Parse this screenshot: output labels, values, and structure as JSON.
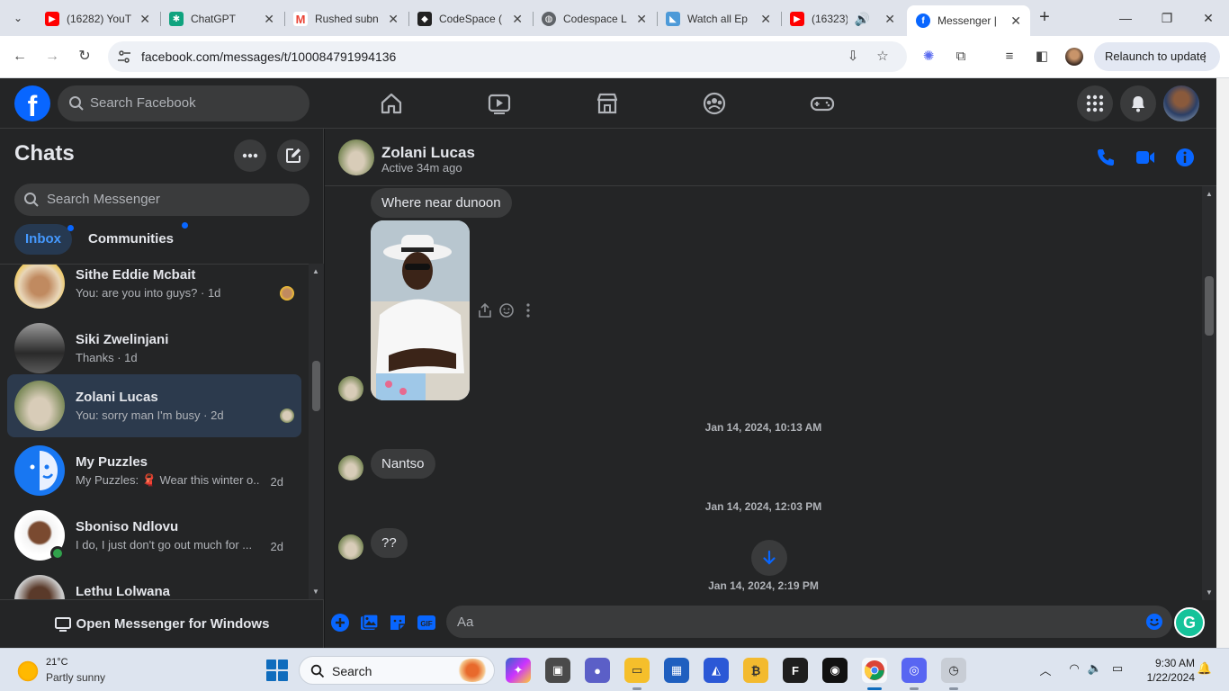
{
  "browser": {
    "tabs": [
      {
        "title": "(16282) YouT",
        "favicon": "youtube-icon"
      },
      {
        "title": "ChatGPT",
        "favicon": "chatgpt-icon"
      },
      {
        "title": "Rushed subn",
        "favicon": "gmail-icon"
      },
      {
        "title": "CodeSpace (",
        "favicon": "codespace-icon"
      },
      {
        "title": "Codespace L",
        "favicon": "globe-icon"
      },
      {
        "title": "Watch all Ep",
        "favicon": "tag-icon"
      },
      {
        "title": "(16323) (",
        "favicon": "youtube-icon"
      },
      {
        "title": "Messenger |",
        "favicon": "facebook-icon"
      }
    ],
    "url": "facebook.com/messages/t/100084791994136",
    "relaunch_label": "Relaunch to update"
  },
  "facebook": {
    "search_placeholder": "Search Facebook",
    "nav": [
      "home-icon",
      "watch-icon",
      "marketplace-icon",
      "groups-icon",
      "gaming-icon"
    ]
  },
  "sidebar": {
    "title": "Chats",
    "search_placeholder": "Search Messenger",
    "filters": [
      {
        "label": "Inbox",
        "active": true
      },
      {
        "label": "Communities",
        "active": false
      }
    ],
    "chats": [
      {
        "name": "Sithe Eddie Mcbait",
        "preview": "You: are you into guys? · 1d",
        "time": "",
        "active": false
      },
      {
        "name": "Siki Zwelinjani",
        "preview": "Thanks · 1d",
        "time": "",
        "active": false
      },
      {
        "name": "Zolani Lucas",
        "preview": "You: sorry man I'm busy · 2d",
        "time": "",
        "active": true
      },
      {
        "name": "My Puzzles",
        "preview": "My Puzzles: 🧣 Wear this winter o...",
        "time": "2d",
        "active": false
      },
      {
        "name": "Sboniso Ndlovu",
        "preview": "I do, I just don't go out much for ...",
        "time": "2d",
        "active": false
      },
      {
        "name": "Lethu Lolwana",
        "preview": "",
        "time": "",
        "active": false
      }
    ],
    "open_windows_label": "Open Messenger for Windows"
  },
  "conversation": {
    "contact_name": "Zolani Lucas",
    "status": "Active 34m ago",
    "messages": [
      {
        "type": "text",
        "text": "Where near dunoon"
      },
      {
        "type": "image",
        "text": ""
      },
      {
        "type": "timestamp",
        "text": "Jan 14, 2024, 10:13 AM"
      },
      {
        "type": "text",
        "text": "Nantso"
      },
      {
        "type": "timestamp",
        "text": "Jan 14, 2024, 12:03 PM"
      },
      {
        "type": "text",
        "text": "??"
      },
      {
        "type": "timestamp",
        "text": "Jan 14, 2024, 2:19 PM"
      }
    ],
    "composer_placeholder": "Aa",
    "composer_icons": [
      "plus-icon",
      "photo-icon",
      "sticker-icon",
      "gif-icon"
    ]
  },
  "taskbar": {
    "weather_temp": "21°C",
    "weather_cond": "Partly sunny",
    "search_placeholder": "Search",
    "time": "9:30 AM",
    "date": "1/22/2024"
  },
  "colors": {
    "fb_blue": "#0866ff",
    "dark_bg": "#242526",
    "bubble": "#3a3b3c",
    "active_chat": "#2c3a4d"
  }
}
